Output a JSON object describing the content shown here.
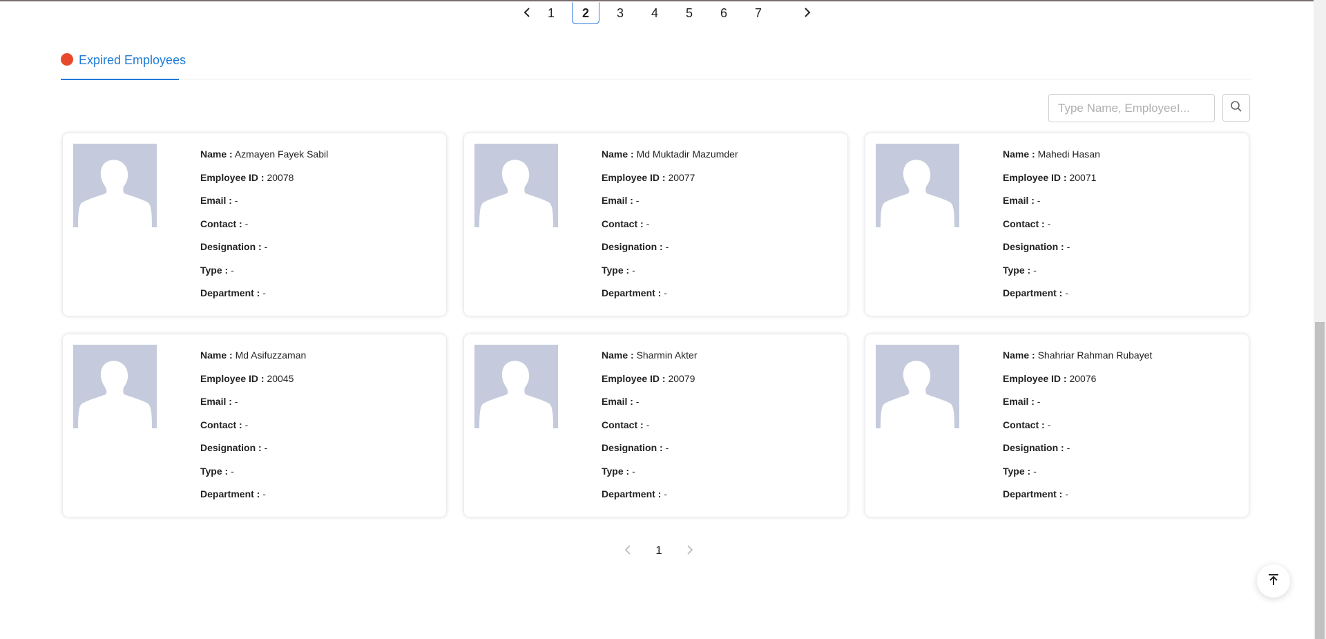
{
  "pagination_top": {
    "prev_icon": "chevron-left-icon",
    "next_icon": "chevron-right-icon",
    "pages": [
      "1",
      "2",
      "3",
      "4",
      "5",
      "6",
      "7"
    ],
    "current": "2"
  },
  "tab": {
    "label": "Expired Employees",
    "dot_color": "#e8492b",
    "accent_color": "#1e7bd8"
  },
  "search": {
    "placeholder": "Type Name, EmployeeI...",
    "icon": "search-icon"
  },
  "labels": {
    "name": "Name :",
    "employee_id": "Employee ID :",
    "email": "Email :",
    "contact": "Contact :",
    "designation": "Designation :",
    "type": "Type :",
    "department": "Department :"
  },
  "employees": [
    {
      "name": "Azmayen Fayek Sabil",
      "employee_id": "20078",
      "email": "-",
      "contact": "-",
      "designation": "-",
      "type": "-",
      "department": "-"
    },
    {
      "name": "Md Muktadir Mazumder",
      "employee_id": "20077",
      "email": "-",
      "contact": "-",
      "designation": "-",
      "type": "-",
      "department": "-"
    },
    {
      "name": "Mahedi Hasan",
      "employee_id": "20071",
      "email": "-",
      "contact": "-",
      "designation": "-",
      "type": "-",
      "department": "-"
    },
    {
      "name": "Md Asifuzzaman",
      "employee_id": "20045",
      "email": "-",
      "contact": "-",
      "designation": "-",
      "type": "-",
      "department": "-"
    },
    {
      "name": "Sharmin Akter",
      "employee_id": "20079",
      "email": "-",
      "contact": "-",
      "designation": "-",
      "type": "-",
      "department": "-"
    },
    {
      "name": "Shahriar Rahman Rubayet",
      "employee_id": "20076",
      "email": "-",
      "contact": "-",
      "designation": "-",
      "type": "-",
      "department": "-"
    }
  ],
  "pagination_bottom": {
    "prev_icon": "chevron-left-icon",
    "next_icon": "chevron-right-icon",
    "pages": [
      "1"
    ],
    "current": "1"
  },
  "back_to_top": {
    "icon": "arrow-up-to-line-icon"
  }
}
